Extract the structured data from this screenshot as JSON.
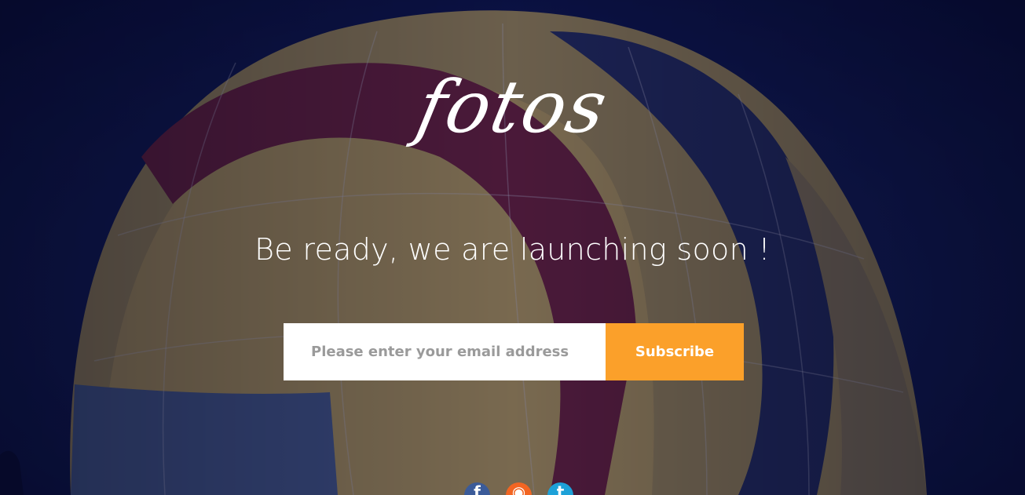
{
  "logo": {
    "text": "fotos"
  },
  "headline": "Be ready, we are launching soon !",
  "subscribe_form": {
    "email_placeholder": "Please enter your email address",
    "button_label": "Subscribe"
  },
  "social": [
    {
      "name": "facebook-icon",
      "glyph": "f"
    },
    {
      "name": "rss-icon",
      "glyph": "◉"
    },
    {
      "name": "twitter-icon",
      "glyph": "t"
    }
  ],
  "colors": {
    "accent": "#fba02a",
    "background": "#0c1240",
    "facebook": "#3b5b99",
    "rss": "#f26522",
    "twitter": "#1da1d8"
  }
}
